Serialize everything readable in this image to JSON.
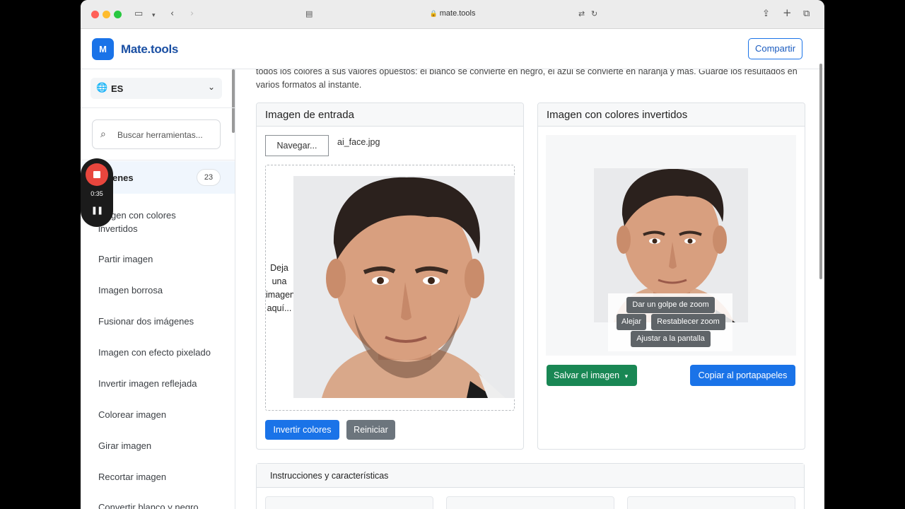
{
  "browser": {
    "url": "mate.tools"
  },
  "site": {
    "logo_letter": "M",
    "logo_text": "Mate.tools",
    "share_label": "Compartir"
  },
  "sidebar": {
    "language": "ES",
    "search_placeholder": "Buscar herramientas...",
    "category": {
      "label": "Imágenes",
      "label_visible": "enes",
      "count": "23"
    },
    "items": [
      "Imagen con colores invertidos",
      "Partir imagen",
      "Imagen borrosa",
      "Fusionar dos imágenes",
      "Imagen con efecto pixelado",
      "Invertir imagen reflejada",
      "Colorear imagen",
      "Girar imagen",
      "Recortar imagen",
      "Convertir blanco y negro"
    ],
    "items_visible": {
      "first": "gen con colores",
      "first_line2": "invertidos"
    }
  },
  "recorder": {
    "time": "0:35"
  },
  "main": {
    "intro": "todos los colores a sus valores opuestos: el blanco se convierte en negro, el azul se convierte en naranja y más. Guarde los resultados en varios formatos al instante.",
    "input_panel": {
      "title": "Imagen de entrada",
      "browse_label": "Navegar...",
      "file_name": "ai_face.jpg",
      "drop_text": "Deja una imagen aquí...",
      "invert_label": "Invertir colores",
      "reset_label": "Reiniciar"
    },
    "output_panel": {
      "title": "Imagen con colores invertidos",
      "zoom_in": "Dar un golpe de zoom",
      "zoom_out": "Alejar",
      "zoom_reset": "Restablecer zoom",
      "zoom_fit": "Ajustar a la pantalla",
      "save_label": "Salvar el imagen",
      "copy_label": "Copiar al portapapeles"
    },
    "instructions_title": "Instrucciones y características"
  },
  "colors": {
    "primary": "#1a73e8",
    "success": "#198754",
    "secondary": "#6c757d",
    "record": "#e8463d"
  }
}
